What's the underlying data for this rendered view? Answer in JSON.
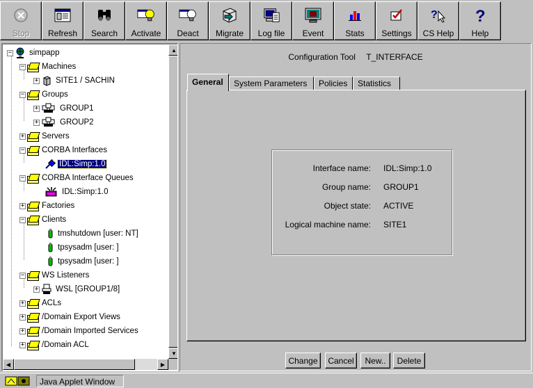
{
  "toolbar": {
    "stop": "Stop",
    "refresh": "Refresh",
    "search": "Search",
    "activate": "Activate",
    "deact": "Deact",
    "migrate": "Migrate",
    "logfile": "Log file",
    "event": "Event",
    "stats": "Stats",
    "settings": "Settings",
    "cshelp": "CS Help",
    "help": "Help"
  },
  "tree": {
    "root": "simpapp",
    "machines": "Machines",
    "site1": "SITE1 / SACHIN",
    "groups": "Groups",
    "group1": "GROUP1",
    "group2": "GROUP2",
    "servers": "Servers",
    "corba_interfaces": "CORBA Interfaces",
    "idl_simp": "IDL:Simp:1.0",
    "corba_queues": "CORBA Interface Queues",
    "idl_simp_queue": "IDL:Simp:1.0",
    "factories": "Factories",
    "clients": "Clients",
    "client1": "tmshutdown [user: NT]",
    "client2": "tpsysadm [user: ]",
    "client3": "tpsysadm [user: ]",
    "ws_listeners": "WS Listeners",
    "wsl": "WSL [GROUP1/8]",
    "acls": "ACLs",
    "export_views": "/Domain Export Views",
    "imported_services": "/Domain Imported Services",
    "domain_acl": "/Domain ACL"
  },
  "panel": {
    "config_tool": "Configuration Tool",
    "interface_type": "T_INTERFACE",
    "tabs": [
      "General",
      "System Parameters",
      "Policies",
      "Statistics"
    ],
    "fields": [
      {
        "label": "Interface name:",
        "value": "IDL:Simp:1.0"
      },
      {
        "label": "Group name:",
        "value": "GROUP1"
      },
      {
        "label": "Object state:",
        "value": "ACTIVE"
      },
      {
        "label": "Logical machine name:",
        "value": "SITE1"
      }
    ],
    "buttons": {
      "change": "Change",
      "cancel": "Cancel",
      "new": "New..",
      "delete": "Delete"
    }
  },
  "status": {
    "text": "Java Applet Window"
  },
  "colors": {
    "selection": "#000080",
    "folder": "#ffff00",
    "background": "#c0c0c0"
  }
}
